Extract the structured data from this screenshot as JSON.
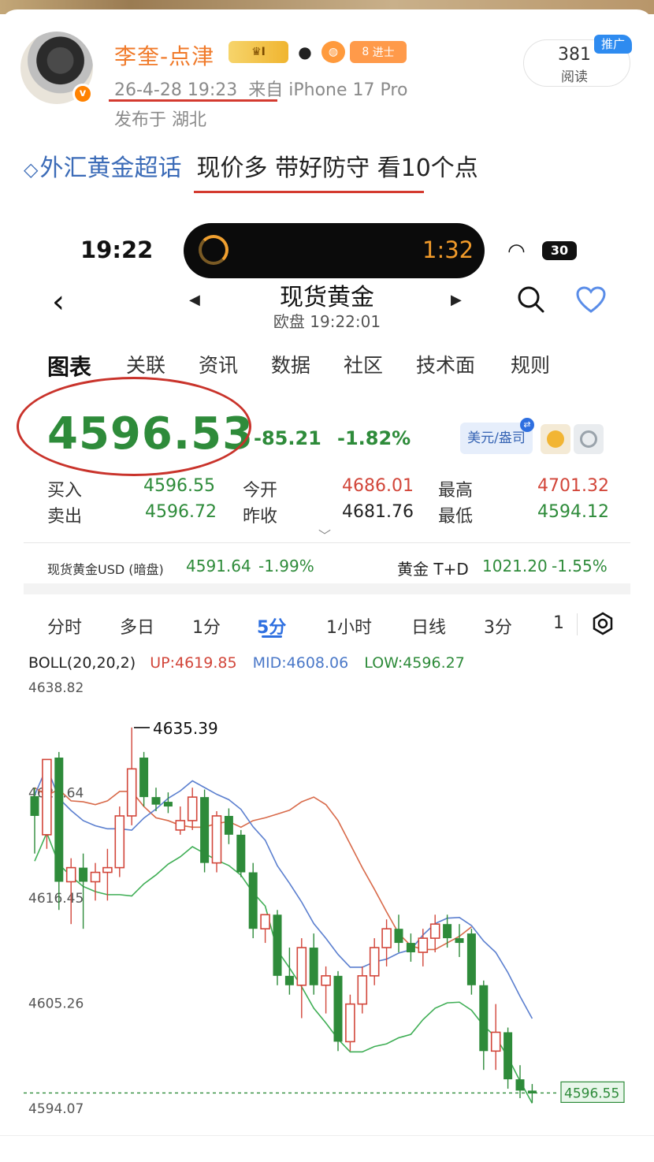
{
  "post": {
    "username": "李奎-点津",
    "badge_crown": "I",
    "badge_level": "8",
    "badge_jinshi": "进士",
    "timestamp": "26-4-28 19:23",
    "source": "来自 iPhone 17 Pro",
    "location": "发布于 湖北",
    "reads_count": "381",
    "reads_label": "阅读",
    "promo_label": "推广",
    "topic": "外汇黄金超话",
    "text": "现价多 带好防守 看10个点"
  },
  "status": {
    "time": "19:22",
    "timer": "1:32",
    "battery": "30"
  },
  "quote": {
    "title": "现货黄金",
    "subtitle": "欧盘 19:22:01",
    "tabs": [
      "图表",
      "关联",
      "资讯",
      "数据",
      "社区",
      "技术面",
      "规则"
    ],
    "price": "4596.53",
    "change": "-85.21",
    "change_pct": "-1.82%",
    "currency_button": "美元/盎司",
    "buy_label": "买入",
    "buy": "4596.55",
    "sell_label": "卖出",
    "sell": "4596.72",
    "open_label": "今开",
    "open": "4686.01",
    "prev_label": "昨收",
    "prev_close": "4681.76",
    "high_label": "最高",
    "high": "4701.32",
    "low_label": "最低",
    "low": "4594.12",
    "ticker1_name": "现货黄金USD (暗盘)",
    "ticker1_price": "4591.64",
    "ticker1_pct": "-1.99%",
    "ticker2_name": "黄金 T+D",
    "ticker2_price": "1021.20",
    "ticker2_pct": "-1.55%",
    "periods": [
      "分时",
      "多日",
      "1分",
      "5分",
      "1小时",
      "日线",
      "3分",
      "1"
    ],
    "colors": {
      "up": "#d2463a",
      "down": "#2e8b3a",
      "accent": "#2e6fe0"
    }
  },
  "chart_data": {
    "type": "candlestick",
    "indicator_label": "BOLL(20,20,2)",
    "up_label": "UP:4619.85",
    "mid_label": "MID:4608.06",
    "low_label": "LOW:4596.27",
    "y_ticks": [
      "4638.82",
      "4627.64",
      "4616.45",
      "4605.26",
      "4594.07"
    ],
    "ylim": [
      4594.07,
      4638.82
    ],
    "max_annotation": "4635.39",
    "last_price_tag": "4596.55",
    "candles": [
      {
        "o": 4628.1,
        "h": 4629.0,
        "l": 4622.0,
        "c": 4626.0
      },
      {
        "o": 4624.0,
        "h": 4631.0,
        "l": 4622.5,
        "c": 4632.0
      },
      {
        "o": 4632.2,
        "h": 4632.8,
        "l": 4616.0,
        "c": 4619.0
      },
      {
        "o": 4619.0,
        "h": 4621.5,
        "l": 4614.5,
        "c": 4620.5
      },
      {
        "o": 4620.5,
        "h": 4622.0,
        "l": 4614.0,
        "c": 4619.0
      },
      {
        "o": 4619.0,
        "h": 4621.0,
        "l": 4617.0,
        "c": 4620.0
      },
      {
        "o": 4620.0,
        "h": 4622.5,
        "l": 4617.0,
        "c": 4620.5
      },
      {
        "o": 4620.5,
        "h": 4627.0,
        "l": 4619.5,
        "c": 4626.0
      },
      {
        "o": 4626.0,
        "h": 4635.4,
        "l": 4625.0,
        "c": 4631.0
      },
      {
        "o": 4632.2,
        "h": 4632.8,
        "l": 4627.0,
        "c": 4628.0
      },
      {
        "o": 4628.0,
        "h": 4629.0,
        "l": 4626.5,
        "c": 4627.2
      },
      {
        "o": 4627.5,
        "h": 4628.5,
        "l": 4626.3,
        "c": 4627.0
      },
      {
        "o": 4624.5,
        "h": 4627.0,
        "l": 4624.0,
        "c": 4625.5
      },
      {
        "o": 4625.5,
        "h": 4629.0,
        "l": 4624.5,
        "c": 4628.0
      },
      {
        "o": 4628.0,
        "h": 4628.8,
        "l": 4620.0,
        "c": 4621.0
      },
      {
        "o": 4621.0,
        "h": 4626.5,
        "l": 4620.0,
        "c": 4626.0
      },
      {
        "o": 4626.0,
        "h": 4626.8,
        "l": 4623.0,
        "c": 4624.0
      },
      {
        "o": 4624.0,
        "h": 4624.5,
        "l": 4619.5,
        "c": 4620.0
      },
      {
        "o": 4620.0,
        "h": 4621.0,
        "l": 4613.0,
        "c": 4614.0
      },
      {
        "o": 4614.0,
        "h": 4615.5,
        "l": 4612.5,
        "c": 4615.5
      },
      {
        "o": 4615.5,
        "h": 4616.0,
        "l": 4608.0,
        "c": 4609.0
      },
      {
        "o": 4609.0,
        "h": 4612.0,
        "l": 4607.0,
        "c": 4608.0
      },
      {
        "o": 4608.0,
        "h": 4613.0,
        "l": 4604.5,
        "c": 4612.0
      },
      {
        "o": 4612.0,
        "h": 4613.5,
        "l": 4607.0,
        "c": 4608.0
      },
      {
        "o": 4608.0,
        "h": 4610.0,
        "l": 4605.0,
        "c": 4609.0
      },
      {
        "o": 4609.0,
        "h": 4609.5,
        "l": 4601.0,
        "c": 4602.0
      },
      {
        "o": 4602.0,
        "h": 4607.0,
        "l": 4601.0,
        "c": 4606.0
      },
      {
        "o": 4606.0,
        "h": 4610.0,
        "l": 4605.0,
        "c": 4609.0
      },
      {
        "o": 4609.0,
        "h": 4613.0,
        "l": 4608.0,
        "c": 4612.0
      },
      {
        "o": 4612.0,
        "h": 4615.0,
        "l": 4610.0,
        "c": 4614.0
      },
      {
        "o": 4614.0,
        "h": 4615.5,
        "l": 4611.5,
        "c": 4612.5
      },
      {
        "o": 4612.5,
        "h": 4613.5,
        "l": 4610.5,
        "c": 4611.5
      },
      {
        "o": 4611.5,
        "h": 4614.0,
        "l": 4610.0,
        "c": 4613.0
      },
      {
        "o": 4613.0,
        "h": 4615.5,
        "l": 4611.5,
        "c": 4614.5
      },
      {
        "o": 4614.5,
        "h": 4615.5,
        "l": 4612.0,
        "c": 4613.0
      },
      {
        "o": 4613.0,
        "h": 4614.5,
        "l": 4611.0,
        "c": 4612.5
      },
      {
        "o": 4613.5,
        "h": 4614.0,
        "l": 4607.0,
        "c": 4608.0
      },
      {
        "o": 4608.0,
        "h": 4608.5,
        "l": 4599.0,
        "c": 4601.0
      },
      {
        "o": 4601.0,
        "h": 4606.0,
        "l": 4599.0,
        "c": 4603.0
      },
      {
        "o": 4603.0,
        "h": 4603.5,
        "l": 4597.0,
        "c": 4598.0
      },
      {
        "o": 4598.0,
        "h": 4599.5,
        "l": 4596.0,
        "c": 4596.8
      },
      {
        "o": 4596.8,
        "h": 4597.5,
        "l": 4595.5,
        "c": 4596.5
      }
    ],
    "boll_up": [
      4629.0,
      4628.2,
      4628.8,
      4627.6,
      4627.5,
      4627.2,
      4627.6,
      4628.6,
      4628.6,
      4627.0,
      4625.8,
      4625.5,
      4625.0,
      4624.8,
      4624.8,
      4625.2,
      4625.4,
      4624.8,
      4625.5,
      4625.8,
      4626.2,
      4626.6,
      4627.5,
      4628.0,
      4627.2,
      4625.5,
      4623.0,
      4620.5,
      4618.2,
      4615.8,
      4613.5,
      4612.2,
      4611.8,
      4611.8,
      4612.5,
      4613.2,
      4614.2
    ]
  }
}
